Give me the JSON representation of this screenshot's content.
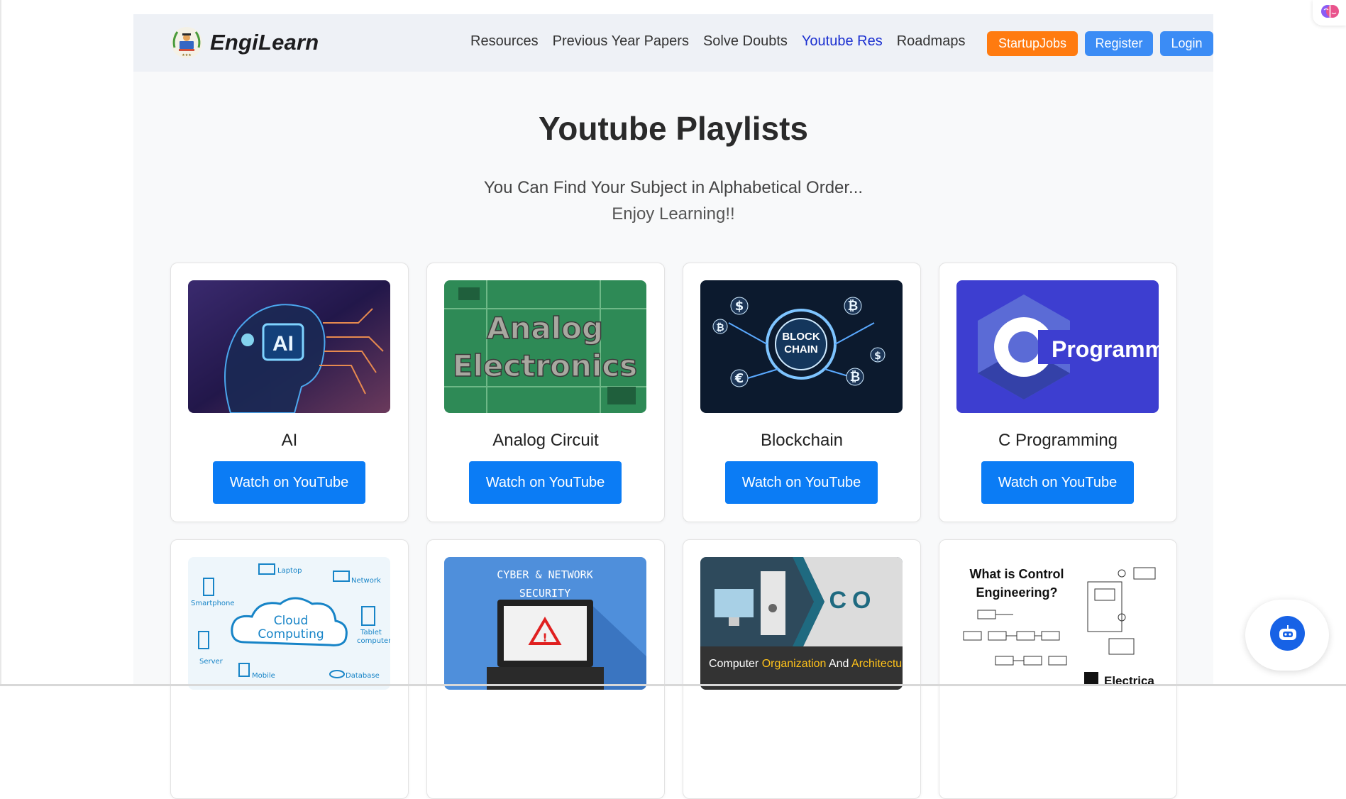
{
  "brand": {
    "name": "EngiLearn",
    "logo_icon": "engilearn-logo-icon"
  },
  "nav": {
    "links": [
      {
        "label": "Resources",
        "active": false
      },
      {
        "label": "Previous Year Papers",
        "active": false
      },
      {
        "label": "Solve Doubts",
        "active": false
      },
      {
        "label": "Youtube Res",
        "active": true
      },
      {
        "label": "Roadmaps",
        "active": false
      }
    ],
    "startup_label": "StartupJobs",
    "register_label": "Register",
    "login_label": "Login"
  },
  "hero": {
    "title": "Youtube Playlists",
    "subtitle_line1": "You Can Find Your Subject in Alphabetical Order...",
    "subtitle_line2": "Enjoy Learning!!"
  },
  "cards": [
    {
      "title": "AI",
      "button": "Watch on YouTube",
      "thumb_text": "AI"
    },
    {
      "title": "Analog Circuit",
      "button": "Watch on YouTube",
      "thumb_line1": "Analog",
      "thumb_line2": "Electronics"
    },
    {
      "title": "Blockchain",
      "button": "Watch on YouTube",
      "thumb_line1": "BLOCK",
      "thumb_line2": "CHAIN"
    },
    {
      "title": "C Programming",
      "button": "Watch on YouTube",
      "thumb_text": "Programming"
    },
    {
      "title": "",
      "button": "",
      "thumb_line1": "Cloud",
      "thumb_line2": "Computing",
      "thumb_labels": [
        "Laptop",
        "Network",
        "Smartphone",
        "Tablet",
        "computer",
        "Server",
        "Mobile",
        "Database"
      ]
    },
    {
      "title": "",
      "button": "",
      "thumb_line1": "CYBER & NETWORK",
      "thumb_line2": "SECURITY"
    },
    {
      "title": "",
      "button": "",
      "thumb_caption_a": "Computer ",
      "thumb_caption_b": "Organization",
      "thumb_caption_c": " And ",
      "thumb_caption_d": "Architecture",
      "thumb_big": "CO"
    },
    {
      "title": "",
      "button": "",
      "thumb_line1": "What is Control",
      "thumb_line2": "Engineering?",
      "thumb_badge": "Electrica"
    }
  ],
  "colors": {
    "accent_blue": "#0b7cf5",
    "nav_active": "#1a2fd0",
    "startup_orange": "#ff7b10",
    "auth_blue": "#3b8cf5"
  },
  "fab": {
    "icon": "chatbot-icon"
  },
  "extension": {
    "icon": "brain-extension-icon"
  }
}
